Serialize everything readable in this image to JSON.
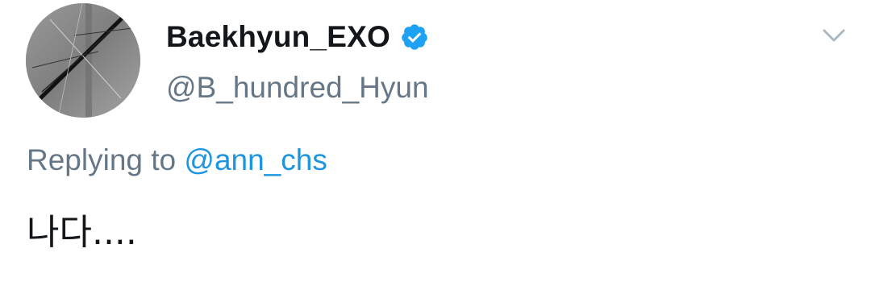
{
  "tweet": {
    "author": {
      "display_name": "Baekhyun_EXO",
      "handle": "@B_hundred_Hyun",
      "verified": true,
      "avatar_icon": "profile-avatar-cracked-glass"
    },
    "reply": {
      "prefix": "Replying to",
      "mention": "@ann_chs"
    },
    "text": "나다....",
    "menu_icon": "chevron-down-icon"
  },
  "colors": {
    "name": "#14171a",
    "secondary_text": "#657786",
    "link": "#1b95e0",
    "verified_badge": "#1da1f2",
    "background": "#ffffff"
  }
}
